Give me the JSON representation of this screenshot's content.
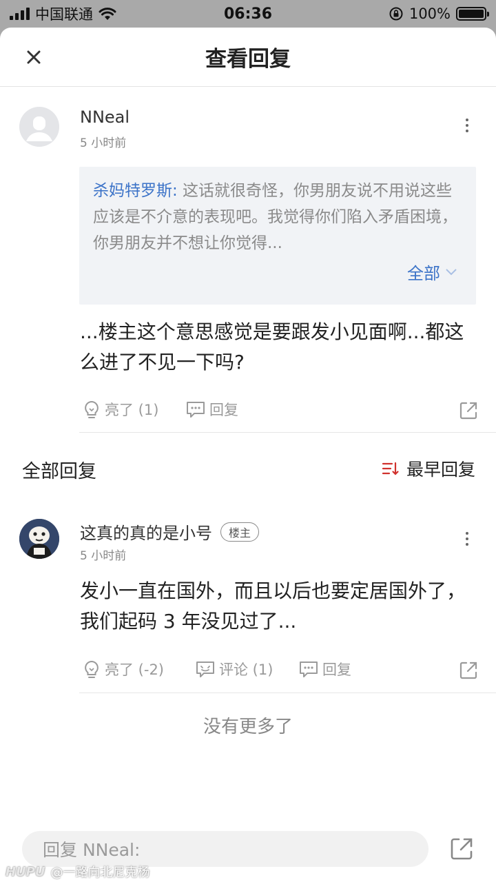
{
  "status_bar": {
    "carrier": "中国联通",
    "time": "06:36",
    "battery": "100%"
  },
  "header": {
    "title": "查看回复"
  },
  "main_comment": {
    "username": "NNeal",
    "time": "5 小时前",
    "quote": {
      "author": "杀妈特罗斯:",
      "text": " 这话就很奇怪，你男朋友说不用说这些应该是不介意的表现吧。我觉得你们陷入矛盾困境，你男朋友并不想让你觉得...",
      "expand_label": "全部"
    },
    "content": "...楼主这个意思感觉是要跟发小见面啊...都这么进了不见一下吗?",
    "actions": {
      "like": "亮了 (1)",
      "reply": "回复"
    }
  },
  "section": {
    "title": "全部回复",
    "sort_label": "最早回复"
  },
  "replies": [
    {
      "username": "这真的真的是小号",
      "badge": "楼主",
      "time": "5 小时前",
      "content": "发小一直在国外，而且以后也要定居国外了，我们起码 3 年没见过了...",
      "actions": {
        "like": "亮了 (-2)",
        "comment": "评论 (1)",
        "reply": "回复"
      }
    }
  ],
  "footer": {
    "no_more": "没有更多了",
    "input_placeholder": "回复 NNeal:"
  },
  "watermark": {
    "brand": "HUPU",
    "handle": "@一路向北尼克杨"
  },
  "colors": {
    "link_blue": "#3c73c8",
    "sort_red": "#d0312d",
    "quote_bg": "#f1f3f6"
  }
}
